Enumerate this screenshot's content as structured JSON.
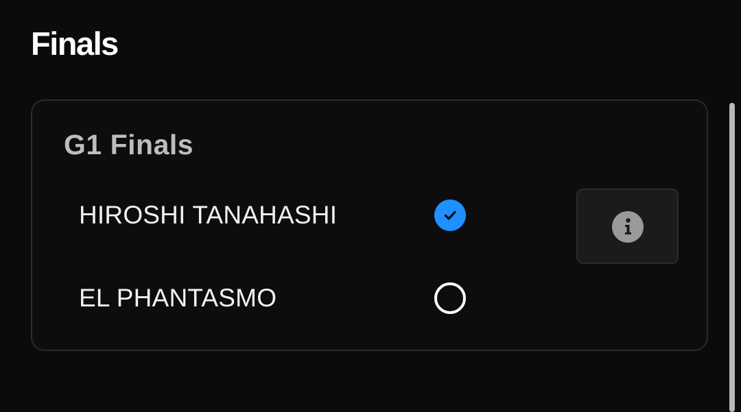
{
  "page": {
    "title": "Finals"
  },
  "card": {
    "title": "G1 Finals",
    "options": [
      {
        "label": "HIROSHI TANAHASHI",
        "selected": true
      },
      {
        "label": "EL PHANTASMO",
        "selected": false
      }
    ],
    "info_icon": "info-icon"
  },
  "colors": {
    "background": "#0b0b0c",
    "accent": "#1e90ff",
    "card_title": "#bdbdbd",
    "info_icon": "#9a9a9a"
  }
}
